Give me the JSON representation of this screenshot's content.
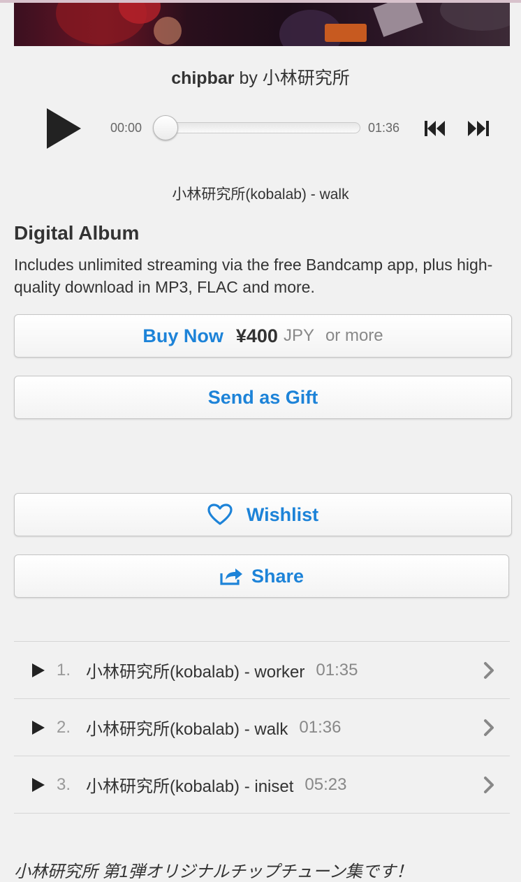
{
  "album": {
    "title": "chipbar",
    "by": "by",
    "artist": "小林研究所"
  },
  "player": {
    "current_time": "00:00",
    "duration": "01:36",
    "progress_fraction": 0,
    "now_playing": "小林研究所(kobalab) - walk",
    "icons": {
      "play": "play-icon",
      "prev": "skip-previous-icon",
      "next": "skip-next-icon"
    }
  },
  "purchase": {
    "heading": "Digital Album",
    "description": "Includes unlimited streaming via the free Bandcamp app, plus high-quality download in MP3, FLAC and more.",
    "buy_label": "Buy Now",
    "price": "¥400",
    "currency": "JPY",
    "or_more": "or more",
    "gift_label": "Send as Gift"
  },
  "actions": {
    "wishlist_label": "Wishlist",
    "share_label": "Share",
    "icons": {
      "wishlist": "heart-icon",
      "share": "share-icon"
    }
  },
  "tracks": [
    {
      "num": "1.",
      "title": "小林研究所(kobalab) - worker",
      "duration": "01:35"
    },
    {
      "num": "2.",
      "title": "小林研究所(kobalab) - walk",
      "duration": "01:36"
    },
    {
      "num": "3.",
      "title": "小林研究所(kobalab) - iniset",
      "duration": "05:23"
    }
  ],
  "about": "小林研究所 第1弾オリジナルチップチューン集です！",
  "colors": {
    "accent": "#1d83d8",
    "background": "#f1f1f1",
    "text": "#333333"
  }
}
